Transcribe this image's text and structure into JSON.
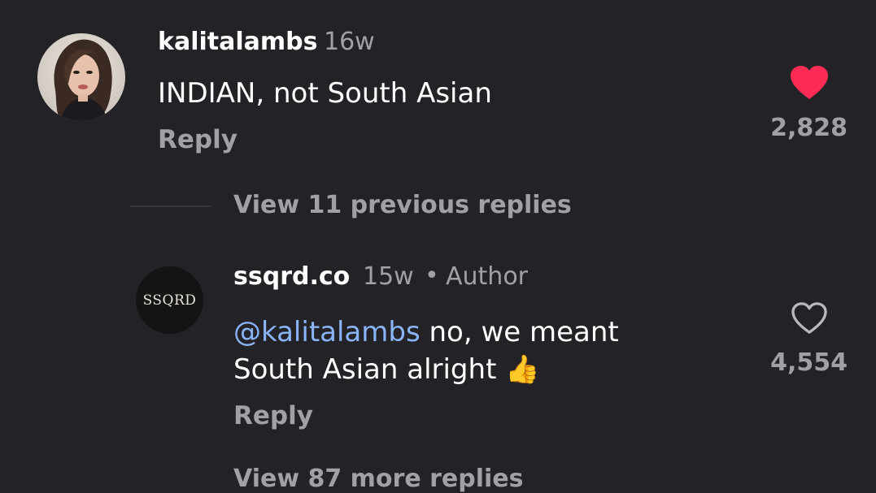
{
  "colors": {
    "background": "#232327",
    "primary_text": "#ffffff",
    "secondary_text": "#a0a0a6",
    "mention": "#8ab4f8",
    "liked_heart": "#fe2c55"
  },
  "comments": [
    {
      "username": "kalitalambs",
      "time": "16w",
      "text": "INDIAN, not South Asian",
      "reply_label": "Reply",
      "like_count": "2,828",
      "liked": true,
      "avatar": "profile-photo"
    }
  ],
  "view_previous": {
    "label": "View 11 previous replies"
  },
  "reply": {
    "username": "ssqrd.co",
    "time": "15w",
    "separator": "•",
    "badge": "Author",
    "avatar_logo_text": "SSQRD",
    "mention": "@kalitalambs",
    "text_line1_rest": " no, we meant",
    "text_line2": "South Asian alright",
    "emoji": "👍",
    "reply_label": "Reply",
    "like_count": "4,554",
    "liked": false
  },
  "view_more": {
    "label": "View 87 more replies"
  }
}
